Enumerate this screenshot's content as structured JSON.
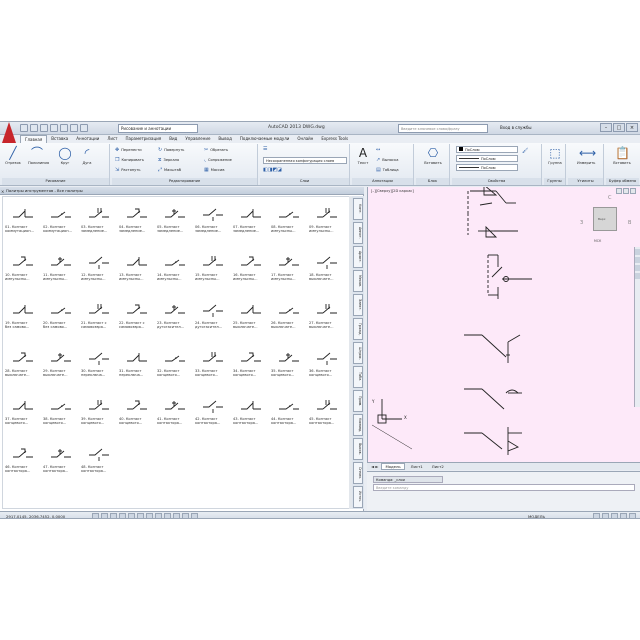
{
  "titlebar": {
    "workspace": "Рисование и аннотации",
    "title": "AutoCAD 2013   DWG.dwg",
    "search_placeholder": "Введите ключевое слово/фразу",
    "login": "Вход в службы"
  },
  "tabs": [
    "Главная",
    "Вставка",
    "Аннотации",
    "Лист",
    "Параметризация",
    "Вид",
    "Управление",
    "Вывод",
    "Подключаемые модули",
    "Онлайн",
    "Express Tools"
  ],
  "ribbon": {
    "draw": {
      "title": "Рисование",
      "line": "Отрезок",
      "polyline": "Полилиния",
      "circle": "Круг",
      "arc": "Дуга"
    },
    "modify": {
      "title": "Редактирование",
      "move": "Перенести",
      "rotate": "Повернуть",
      "trim": "Обрезать",
      "copy": "Копировать",
      "mirror": "Зеркало",
      "fillet": "Сопряжение",
      "stretch": "Растянуть",
      "scale": "Масштаб",
      "array": "Массив"
    },
    "layers": {
      "title": "Слои",
      "current": "Несохраненная конфигурация слоев"
    },
    "annotation": {
      "title": "Аннотации",
      "text": "Текст",
      "leader": "Выноска",
      "table": "Таблица"
    },
    "block": {
      "title": "Блок",
      "insert": "Вставить"
    },
    "properties": {
      "title": "Свойства",
      "color": "ПоСлою",
      "linetype": "ПоСлою",
      "lineweight": "ПоСлою"
    },
    "groups": {
      "title": "Группы",
      "group": "Группа"
    },
    "utilities": {
      "title": "Утилиты",
      "measure": "Измерить"
    },
    "clipboard": {
      "title": "Буфер обмена",
      "paste": "Вставить"
    }
  },
  "palette": {
    "title": "Палитры инструментов - Все палитры",
    "side_tabs": [
      "Конт.",
      "Аннот.",
      "Архит.",
      "Механ.",
      "Элект.",
      "Гражд.",
      "Штрих.",
      "Табл.",
      "Прим.",
      "Команд.",
      "Высок.",
      "Сгеом.",
      "Источ."
    ],
    "tools": [
      {
        "n": "01. Контакт",
        "d": "коммутацион..."
      },
      {
        "n": "02. Контакт",
        "d": "коммутацион..."
      },
      {
        "n": "03. Контакт",
        "d": "замедление..."
      },
      {
        "n": "04. Контакт",
        "d": "замедление..."
      },
      {
        "n": "05. Контакт",
        "d": "замедление..."
      },
      {
        "n": "06. Контакт",
        "d": "замедление..."
      },
      {
        "n": "07. Контакт",
        "d": "замедление..."
      },
      {
        "n": "08. Контакт",
        "d": "импульсны..."
      },
      {
        "n": "09. Контакт",
        "d": "импульсны..."
      },
      {
        "n": "10. Контакт",
        "d": "импульсны..."
      },
      {
        "n": "11. Контакт",
        "d": "импульсны..."
      },
      {
        "n": "12. Контакт",
        "d": "импульсны..."
      },
      {
        "n": "13. Контакт",
        "d": "импульсны..."
      },
      {
        "n": "14. Контакт",
        "d": "импульсны..."
      },
      {
        "n": "15. Контакт",
        "d": "импульсны..."
      },
      {
        "n": "16. Контакт",
        "d": "импульсны..."
      },
      {
        "n": "17. Контакт",
        "d": "импульсны..."
      },
      {
        "n": "18. Контакт",
        "d": "выключате..."
      },
      {
        "n": "19. Контакт",
        "d": "без самово..."
      },
      {
        "n": "20. Контакт",
        "d": "без самово..."
      },
      {
        "n": "21. Контакт с",
        "d": "самовозвра..."
      },
      {
        "n": "22. Контакт с",
        "d": "самовозвра..."
      },
      {
        "n": "23. Контакт",
        "d": "дугогасител..."
      },
      {
        "n": "24. Контакт",
        "d": "дугогасител..."
      },
      {
        "n": "25. Контакт",
        "d": "выключате..."
      },
      {
        "n": "26. Контакт",
        "d": "выключате..."
      },
      {
        "n": "27. Контакт",
        "d": "выключате..."
      },
      {
        "n": "28. Контакт",
        "d": "выключате..."
      },
      {
        "n": "29. Контакт",
        "d": "выключате..."
      },
      {
        "n": "30. Контакт",
        "d": "переключа..."
      },
      {
        "n": "31. Контакт",
        "d": "переключа..."
      },
      {
        "n": "32. Контакт",
        "d": "концевого..."
      },
      {
        "n": "33. Контакт",
        "d": "концевого..."
      },
      {
        "n": "34. Контакт",
        "d": "концевого..."
      },
      {
        "n": "35. Контакт",
        "d": "концевого..."
      },
      {
        "n": "36. Контакт",
        "d": "концевого..."
      },
      {
        "n": "37. Контакт",
        "d": "концевого..."
      },
      {
        "n": "38. Контакт",
        "d": "концевого..."
      },
      {
        "n": "39. Контакт",
        "d": "концевого..."
      },
      {
        "n": "40. Контакт",
        "d": "концевого..."
      },
      {
        "n": "41. Контакт",
        "d": "контактора..."
      },
      {
        "n": "42. Контакт",
        "d": "контактора..."
      },
      {
        "n": "43. Контакт",
        "d": "контактора..."
      },
      {
        "n": "44. Контакт",
        "d": "контактора..."
      },
      {
        "n": "45. Контакт",
        "d": "контактора..."
      },
      {
        "n": "46. Контакт",
        "d": "контактора..."
      },
      {
        "n": "47. Контакт",
        "d": "контактора..."
      },
      {
        "n": "48. Контакт",
        "d": "контактора..."
      }
    ]
  },
  "viewport": {
    "label": "[–][Сверху][2D каркас]",
    "cube_n": "С",
    "cube_w": "З",
    "cube_e": "В",
    "cube_face": "Верх",
    "wcs": "МСК"
  },
  "layout_tabs": [
    "Модель",
    "Лист1",
    "Лист2"
  ],
  "command": {
    "bar": "Команда: _слои",
    "placeholder": "Введите команду"
  },
  "status": {
    "coords": "2917.0145, 2036.7452, 0.0000",
    "model": "МОДЕЛЬ"
  }
}
